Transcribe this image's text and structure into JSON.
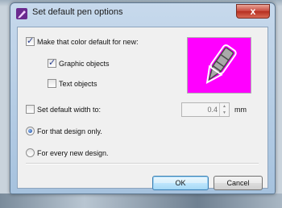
{
  "window": {
    "title": "Set default pen options",
    "close_label": "x"
  },
  "options": {
    "make_default": {
      "label": "Make that color default for new:",
      "checked": true
    },
    "graphic_objects": {
      "label": "Graphic objects",
      "checked": true
    },
    "text_objects": {
      "label": "Text objects",
      "checked": false
    },
    "default_width": {
      "label": "Set default width to:",
      "checked": false
    },
    "width_value": "0.4",
    "width_unit": "mm",
    "scope_this": {
      "label": "For that design only.",
      "checked": true
    },
    "scope_every": {
      "label": "For every new design.",
      "checked": false
    }
  },
  "buttons": {
    "ok": "OK",
    "cancel": "Cancel"
  },
  "colors": {
    "preview_color": "#ff00ff",
    "accent": "#3c7fb1"
  },
  "icons": {
    "app": "pen-app-icon",
    "preview": "pen-icon"
  }
}
